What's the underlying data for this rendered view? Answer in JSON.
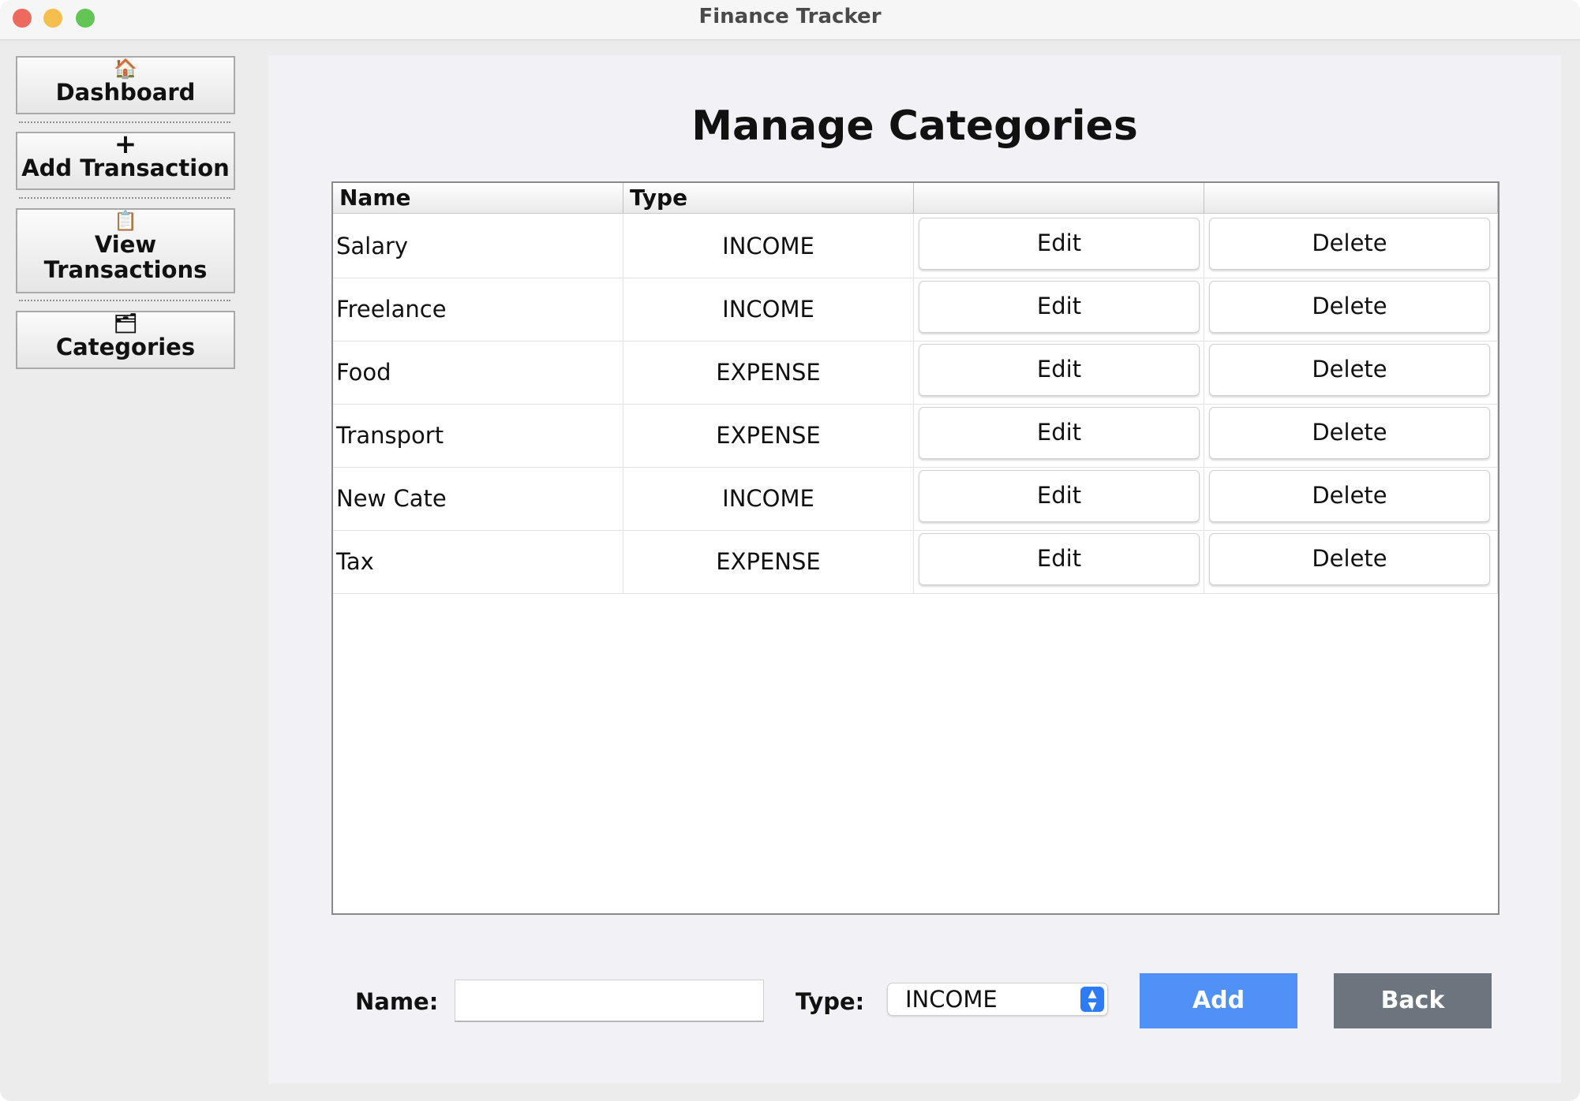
{
  "window": {
    "title": "Finance Tracker"
  },
  "sidebar": {
    "items": [
      {
        "icon": "house-icon",
        "glyph": "🏠",
        "label": "Dashboard"
      },
      {
        "icon": "plus-icon",
        "glyph": "+",
        "label": "Add Transaction"
      },
      {
        "icon": "clipboard-icon",
        "glyph": "📋",
        "label_line1": "View",
        "label_line2": "Transactions"
      },
      {
        "icon": "folder-icon",
        "glyph": "🗂",
        "label": "Categories"
      }
    ]
  },
  "page": {
    "title": "Manage Categories"
  },
  "table": {
    "columns": [
      "Name",
      "Type",
      "",
      ""
    ],
    "rows": [
      {
        "name": "Salary",
        "type": "INCOME",
        "edit": "Edit",
        "delete": "Delete"
      },
      {
        "name": "Freelance",
        "type": "INCOME",
        "edit": "Edit",
        "delete": "Delete"
      },
      {
        "name": "Food",
        "type": "EXPENSE",
        "edit": "Edit",
        "delete": "Delete"
      },
      {
        "name": "Transport",
        "type": "EXPENSE",
        "edit": "Edit",
        "delete": "Delete"
      },
      {
        "name": "New Cate",
        "type": "INCOME",
        "edit": "Edit",
        "delete": "Delete"
      },
      {
        "name": "Tax",
        "type": "EXPENSE",
        "edit": "Edit",
        "delete": "Delete"
      }
    ]
  },
  "form": {
    "name_label": "Name:",
    "name_value": "",
    "type_label": "Type:",
    "type_selected": "INCOME",
    "add_label": "Add",
    "back_label": "Back"
  },
  "colors": {
    "add_button": "#4f91f7",
    "back_button": "#6c757d",
    "select_arrow": "#2d7cf6"
  }
}
